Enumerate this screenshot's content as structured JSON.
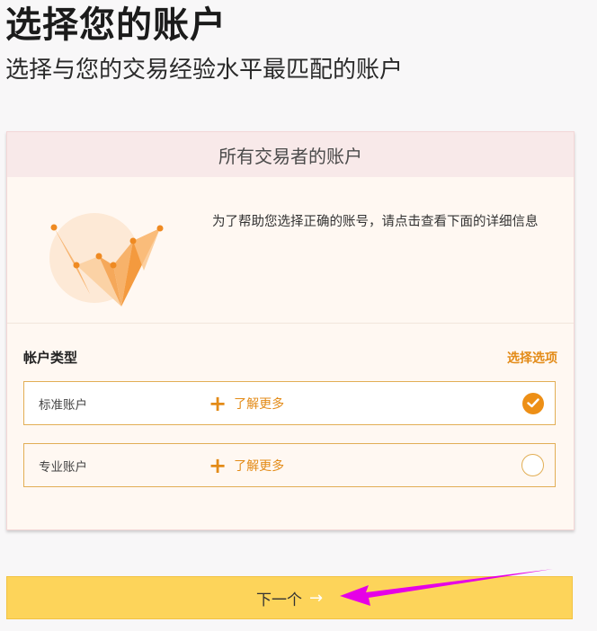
{
  "page": {
    "title": "选择您的账户",
    "subtitle": "选择与您的交易经验水平最匹配的账户"
  },
  "card": {
    "header": "所有交易者的账户",
    "info_text": "为了帮助您选择正确的账号，请点击查看下面的详细信息",
    "section_label": "帐户类型",
    "select_option_link": "选择选项",
    "options": [
      {
        "name": "标准账户",
        "more_label": "了解更多",
        "selected": true
      },
      {
        "name": "专业账户",
        "more_label": "了解更多",
        "selected": false
      }
    ]
  },
  "footer": {
    "next_label": "下一个"
  },
  "colors": {
    "accent": "#e38b18",
    "button": "#fdd45a",
    "annotation_arrow": "#e600e6"
  },
  "icons": {
    "illustration": "growth-chart-illustration",
    "plus": "plus-icon",
    "check": "check-icon",
    "arrow": "arrow-right-icon"
  }
}
